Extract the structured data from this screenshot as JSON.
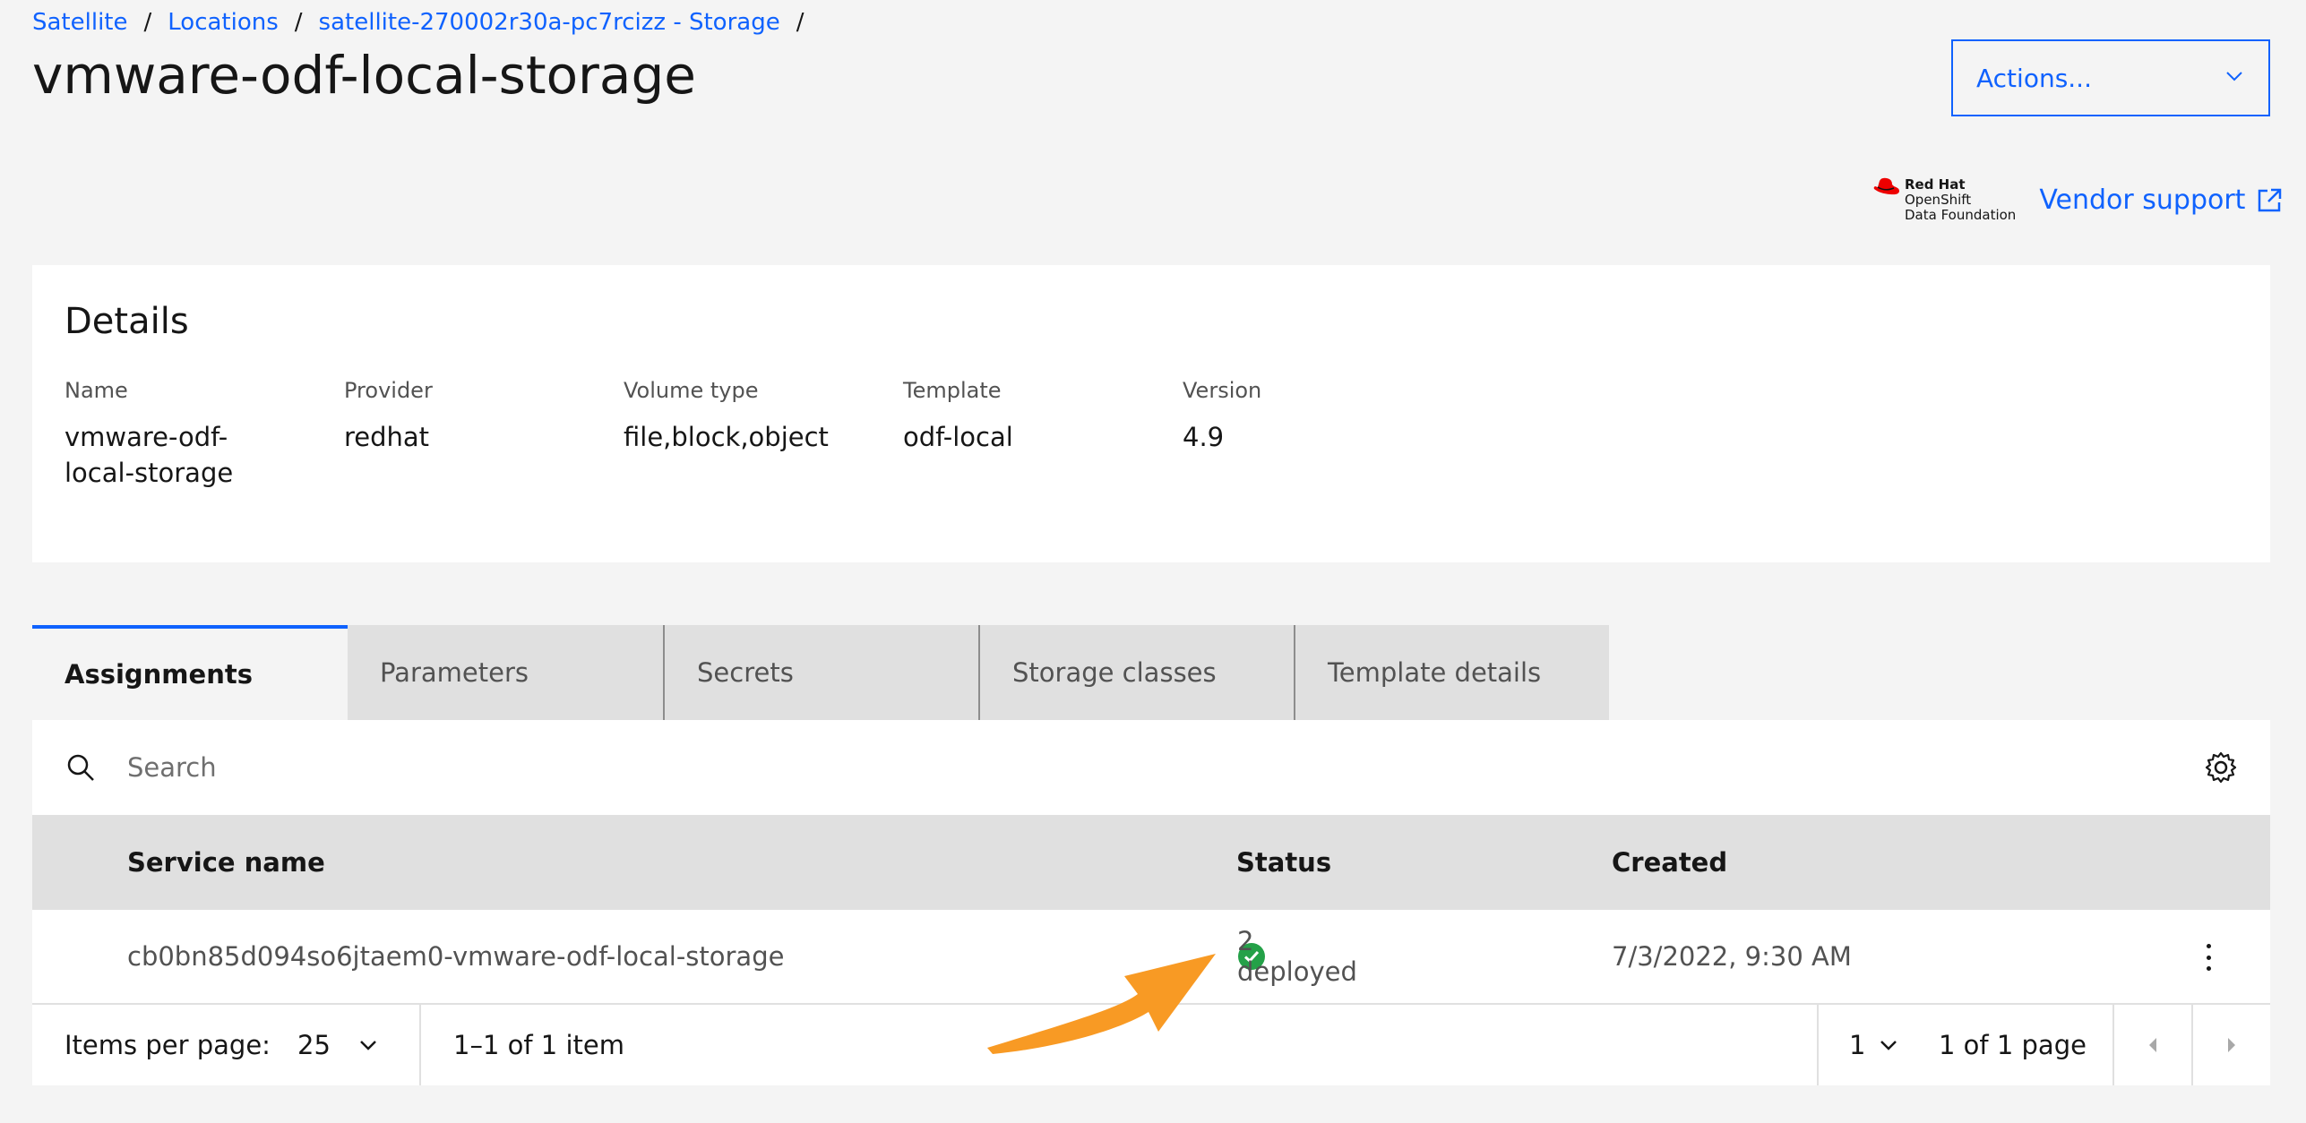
{
  "breadcrumb": [
    "Satellite",
    "Locations",
    "satellite-270002r30a-pc7rcizz - Storage"
  ],
  "breadcrumb_sep": "/",
  "title": "vmware-odf-local-storage",
  "actions_label": "Actions...",
  "vendor": {
    "logo_line1": "Red Hat",
    "logo_line2": "OpenShift",
    "logo_line3": "Data Foundation",
    "support_label": "Vendor support",
    "brand_color": "#ee0000"
  },
  "details": {
    "heading": "Details",
    "fields": [
      {
        "label": "Name",
        "value": "vmware-odf-local-storage"
      },
      {
        "label": "Provider",
        "value": "redhat"
      },
      {
        "label": "Volume type",
        "value": "file,block,object"
      },
      {
        "label": "Template",
        "value": "odf-local"
      },
      {
        "label": "Version",
        "value": "4.9"
      }
    ]
  },
  "tabs": [
    "Assignments",
    "Parameters",
    "Secrets",
    "Storage classes",
    "Template details"
  ],
  "active_tab": "Assignments",
  "search": {
    "placeholder": "Search"
  },
  "table": {
    "headers": {
      "service": "Service name",
      "status": "Status",
      "created": "Created"
    },
    "rows": [
      {
        "service": "cb0bn85d094so6jtaem0-vmware-odf-local-storage",
        "status": "2 deployed",
        "created": "7/3/2022, 9:30 AM"
      }
    ]
  },
  "pagination": {
    "items_per_page_label": "Items per page:",
    "items_per_page": "25",
    "range": "1–1 of 1 item",
    "page": "1",
    "page_count": "1 of 1 page"
  },
  "colors": {
    "accent": "#0f62fe",
    "success": "#24a148",
    "annotation_arrow": "#f89a24"
  }
}
